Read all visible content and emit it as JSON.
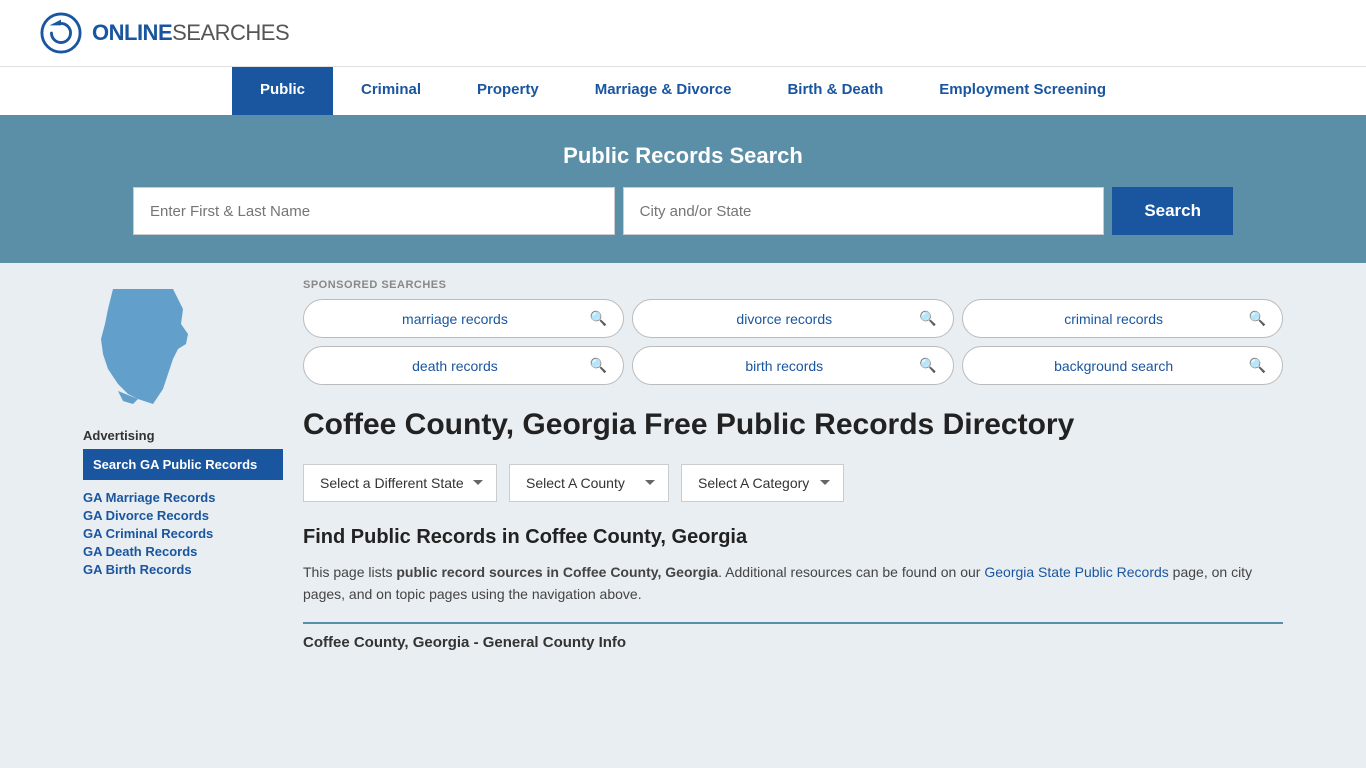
{
  "header": {
    "logo_online": "ONLINE",
    "logo_searches": "SEARCHES"
  },
  "nav": {
    "items": [
      {
        "label": "Public",
        "active": true
      },
      {
        "label": "Criminal",
        "active": false
      },
      {
        "label": "Property",
        "active": false
      },
      {
        "label": "Marriage & Divorce",
        "active": false
      },
      {
        "label": "Birth & Death",
        "active": false
      },
      {
        "label": "Employment Screening",
        "active": false
      }
    ]
  },
  "search_banner": {
    "title": "Public Records Search",
    "name_placeholder": "Enter First & Last Name",
    "location_placeholder": "City and/or State",
    "button_label": "Search"
  },
  "sponsored": {
    "label": "SPONSORED SEARCHES",
    "items": [
      {
        "text": "marriage records"
      },
      {
        "text": "divorce records"
      },
      {
        "text": "criminal records"
      },
      {
        "text": "death records"
      },
      {
        "text": "birth records"
      },
      {
        "text": "background search"
      }
    ]
  },
  "page": {
    "title": "Coffee County, Georgia Free Public Records Directory",
    "dropdowns": {
      "state": "Select a Different State",
      "county": "Select A County",
      "category": "Select A Category"
    },
    "find_title": "Find Public Records in Coffee County, Georgia",
    "find_desc_1": "This page lists ",
    "find_desc_bold": "public record sources in Coffee County, Georgia",
    "find_desc_2": ". Additional resources can be found on our ",
    "find_link_text": "Georgia State Public Records",
    "find_desc_3": " page, on city pages, and on topic pages using the navigation above.",
    "county_info_header": "Coffee County, Georgia - General County Info"
  },
  "sidebar": {
    "advertising_label": "Advertising",
    "ad_block_text": "Search GA Public Records",
    "links": [
      {
        "label": "GA Marriage Records"
      },
      {
        "label": "GA Divorce Records"
      },
      {
        "label": "GA Criminal Records"
      },
      {
        "label": "GA Death Records"
      },
      {
        "label": "GA Birth Records"
      }
    ]
  }
}
